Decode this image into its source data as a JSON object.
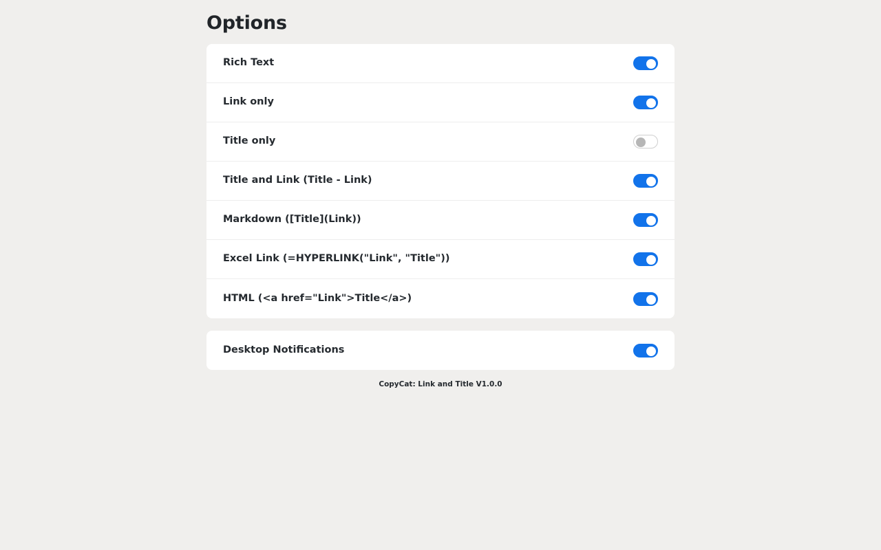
{
  "page": {
    "title": "Options",
    "background_color": "#f0efed",
    "card_color": "#ffffff",
    "accent_color": "#1273ea",
    "toggle_off_knob_color": "#b6b6b6",
    "text_color": "#252a2f"
  },
  "format_options": {
    "items": [
      {
        "label": "Rich Text",
        "enabled": true,
        "state_text": "on"
      },
      {
        "label": "Link only",
        "enabled": true,
        "state_text": "on"
      },
      {
        "label": "Title only",
        "enabled": false,
        "state_text": "off"
      },
      {
        "label": "Title and Link (Title - Link)",
        "enabled": true,
        "state_text": "on"
      },
      {
        "label": "Markdown ([Title](Link))",
        "enabled": true,
        "state_text": "on"
      },
      {
        "label": "Excel Link (=HYPERLINK(\"Link\", \"Title\"))",
        "enabled": true,
        "state_text": "on"
      },
      {
        "label": "HTML (<a href=\"Link\">Title</a>)",
        "enabled": true,
        "state_text": "on"
      }
    ]
  },
  "notification_options": {
    "items": [
      {
        "label": "Desktop Notifications",
        "enabled": true,
        "state_text": "on"
      }
    ]
  },
  "footer": {
    "text": "CopyCat: Link and Title V1.0.0"
  }
}
